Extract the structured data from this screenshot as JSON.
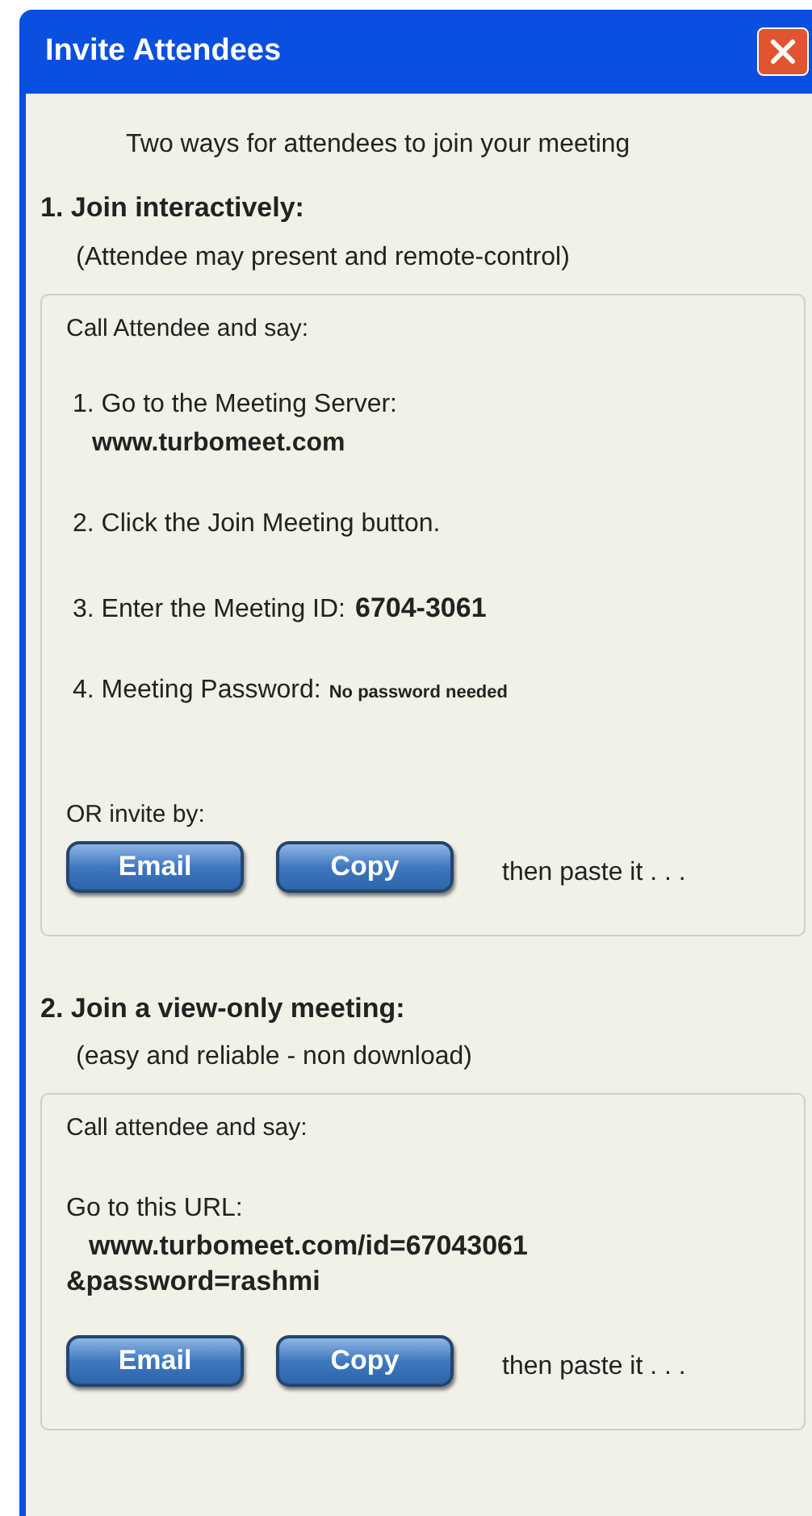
{
  "window": {
    "title": "Invite Attendees"
  },
  "intro": "Two ways for attendees to join your meeting",
  "sections": [
    {
      "heading": "1. Join interactively:",
      "subheading": "(Attendee may present and remote-control)",
      "box_title": "Call Attendee and say:",
      "steps": [
        {
          "kind": "block",
          "text": "1. Go to the Meeting Server:",
          "detail": "www.turbomeet.com"
        },
        {
          "kind": "plain",
          "text": "2. Click the Join Meeting button."
        },
        {
          "kind": "inline",
          "text": "3. Enter the Meeting ID:",
          "detail": "6704-3061"
        },
        {
          "kind": "small",
          "text": "4. Meeting Password:",
          "detail": "No password needed"
        }
      ],
      "invite_label": "OR invite by:",
      "buttons": [
        "Email",
        "Copy"
      ],
      "after_buttons": "then paste it . . ."
    },
    {
      "heading": "2. Join a view-only meeting:",
      "subheading": "(easy and reliable - non download)",
      "box_title": "Call attendee and say:",
      "steps": [
        {
          "kind": "url",
          "text": "Go to this URL:",
          "detail": "www.turbomeet.com/id=67043061",
          "detail_2": "&password=rashmi"
        }
      ],
      "buttons": [
        "Email",
        "Copy"
      ],
      "after_buttons": "then paste it . . ."
    }
  ]
}
